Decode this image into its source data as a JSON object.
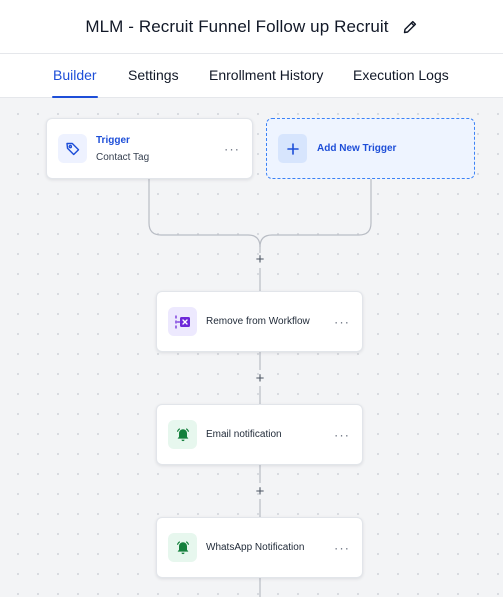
{
  "header": {
    "title": "MLM - Recruit Funnel Follow up Recruit",
    "edit_icon": "pencil-icon"
  },
  "tabs": [
    {
      "label": "Builder",
      "active": true
    },
    {
      "label": "Settings",
      "active": false
    },
    {
      "label": "Enrollment History",
      "active": false
    },
    {
      "label": "Execution Logs",
      "active": false
    }
  ],
  "trigger": {
    "title": "Trigger",
    "subtitle": "Contact Tag",
    "icon": "tag-icon",
    "more_icon": "more-horizontal-icon"
  },
  "add_trigger": {
    "label": "Add New Trigger",
    "icon": "plus-icon"
  },
  "actions": [
    {
      "label": "Remove from Workflow",
      "icon": "remove-workflow-icon"
    },
    {
      "label": "Email notification",
      "icon": "bell-icon"
    },
    {
      "label": "WhatsApp Notification",
      "icon": "bell-icon"
    }
  ],
  "add_step": {
    "symbol": "+"
  },
  "more": {
    "symbol": "···"
  },
  "colors": {
    "accent": "#1d4ed8",
    "trigger_icon_bg": "#eef2ff",
    "remove_icon_bg": "#ede9fe",
    "remove_icon": "#6d28d9",
    "notify_icon_bg": "#e7f7ee",
    "notify_icon": "#15803d"
  }
}
